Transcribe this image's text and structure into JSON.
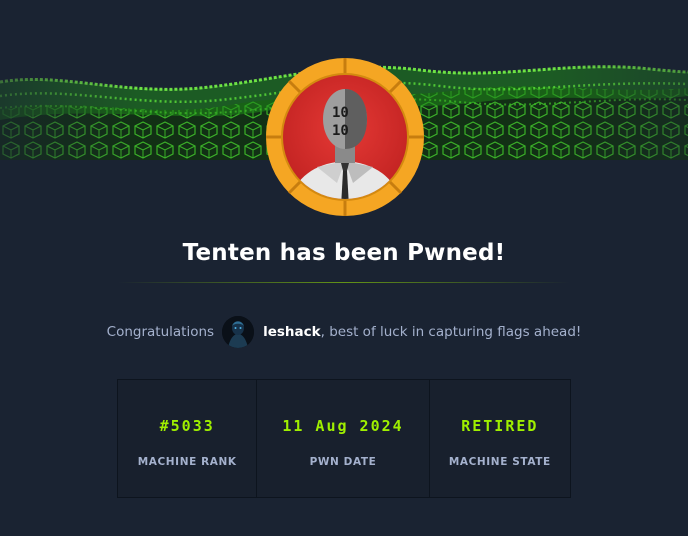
{
  "page": {
    "title": "Tenten has been Pwned!"
  },
  "congrats": {
    "lead": "Congratulations",
    "username": "leshack",
    "message": ", best of luck in capturing flags ahead!"
  },
  "stats": [
    {
      "value": "#5033",
      "label": "MACHINE RANK"
    },
    {
      "value": "11 Aug 2024",
      "label": "PWN DATE"
    },
    {
      "value": "RETIRED",
      "label": "MACHINE STATE"
    }
  ],
  "colors": {
    "background": "#1a2332",
    "accent": "#9fef00",
    "muted_text": "#a4b1cd",
    "avatar_ring": "#f5a623",
    "avatar_bg": "#d32f2f"
  },
  "icons": {
    "machine_avatar": "binary-face-avatar",
    "user_avatar": "user-avatar"
  }
}
